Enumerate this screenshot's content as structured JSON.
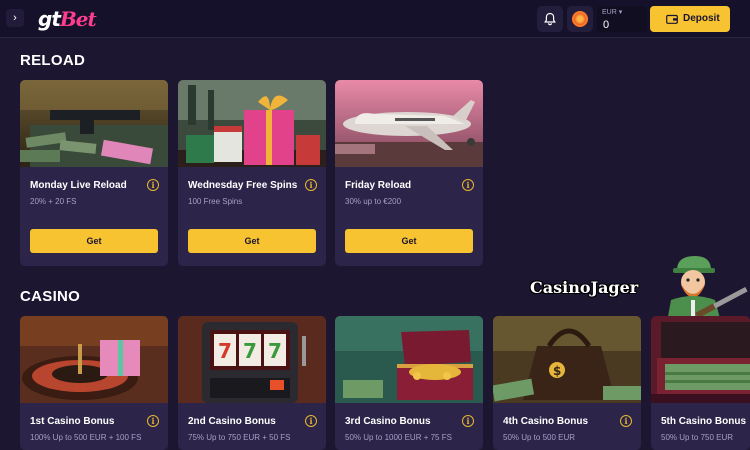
{
  "header": {
    "logo_gt": "gt",
    "logo_bet": "Bet",
    "balance_currency": "EUR ▾",
    "balance_amount": "0",
    "deposit_label": "Deposit"
  },
  "sections": {
    "reload": {
      "title": "RELOAD",
      "cards": [
        {
          "title": "Monday Live Reload",
          "subtitle": "20% + 20 FS",
          "button": "Get",
          "image": "cash-and-gun-table"
        },
        {
          "title": "Wednesday Free Spins",
          "subtitle": "100 Free Spins",
          "button": "Get",
          "image": "gift-box-casino-chips"
        },
        {
          "title": "Friday Reload",
          "subtitle": "30% up to €200",
          "button": "Get",
          "image": "private-jet"
        }
      ]
    },
    "casino": {
      "title": "CASINO",
      "cards": [
        {
          "title": "1st Casino Bonus",
          "subtitle": "100% Up to 500 EUR + 100 FS",
          "image": "roulette-wheel-gift"
        },
        {
          "title": "2nd Casino Bonus",
          "subtitle": "75% Up to 750 EUR + 50 FS",
          "image": "slot-machine-777"
        },
        {
          "title": "3rd Casino Bonus",
          "subtitle": "50% Up to 1000 EUR + 75 FS",
          "image": "treasure-chest-gold"
        },
        {
          "title": "4th Casino Bonus",
          "subtitle": "50% Up to 500 EUR",
          "image": "money-bag"
        },
        {
          "title": "5th Casino Bonus",
          "subtitle": "50% Up to 750 EUR",
          "image": "cash-suitcase"
        }
      ]
    }
  },
  "watermark": "CasinoJager",
  "colors": {
    "background": "#1c1630",
    "card": "#2c2549",
    "accent_yellow": "#f7c331",
    "logo_pink": "#ff3d8e"
  }
}
